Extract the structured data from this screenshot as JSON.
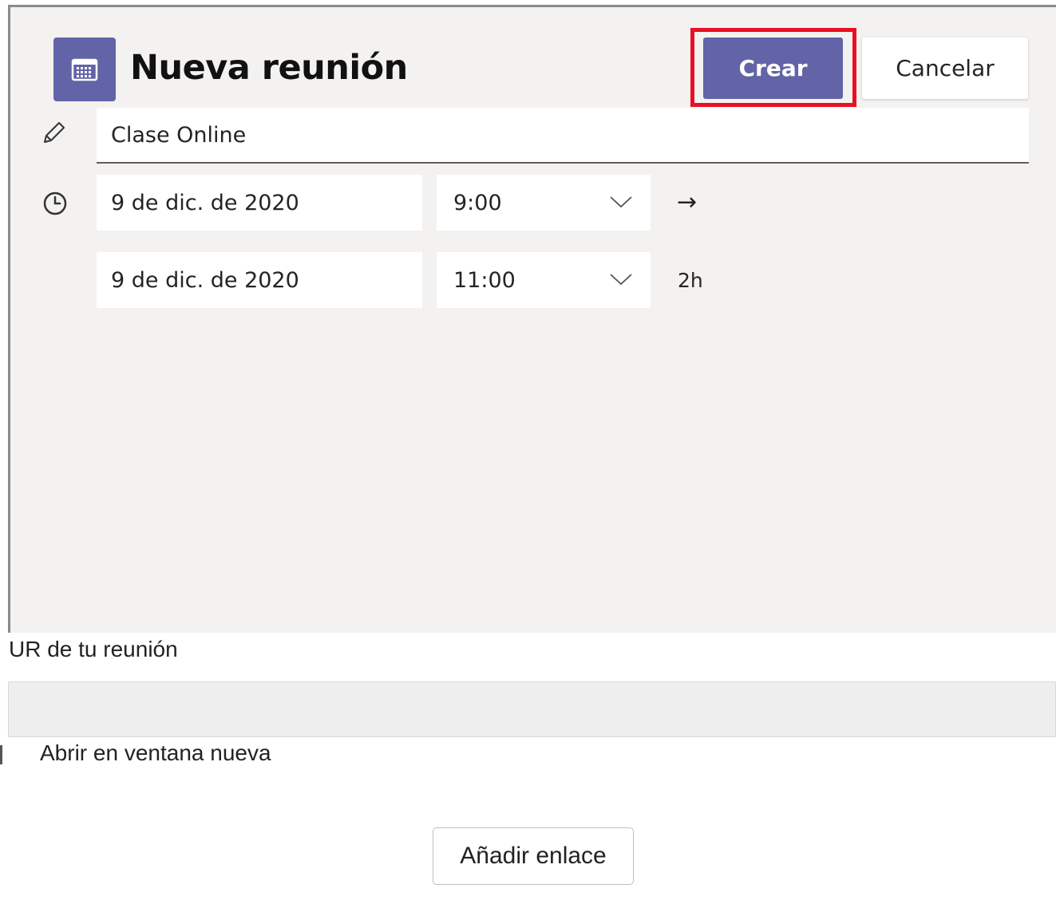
{
  "header": {
    "icon": "calendar-icon",
    "title": "Nueva reunión",
    "create_label": "Crear",
    "cancel_label": "Cancelar",
    "accent_color": "#6264a7",
    "highlight_color": "#e81123"
  },
  "form": {
    "title_value": "Clase Online",
    "start": {
      "date": "9 de dic. de 2020",
      "time": "9:00"
    },
    "end": {
      "date": "9 de dic. de 2020",
      "time": "11:00"
    },
    "arrow": "→",
    "duration": "2h"
  },
  "url_section": {
    "label": "UR de tu reunión",
    "value": "",
    "open_new_window_label": "Abrir en ventana nueva",
    "add_link_label": "Añadir enlace"
  }
}
